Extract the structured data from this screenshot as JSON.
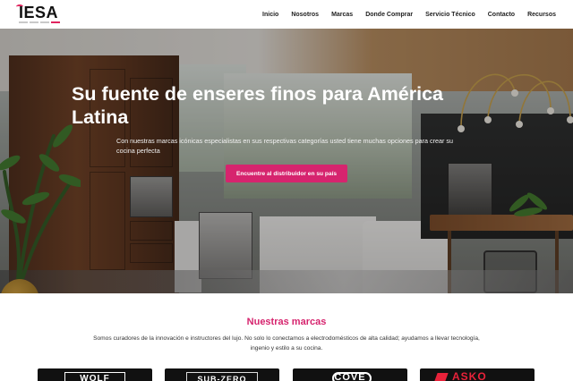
{
  "brand": {
    "logo_text": "IESA",
    "accent": "#d6246e"
  },
  "nav": {
    "items": [
      "Inicio",
      "Nosotros",
      "Marcas",
      "Donde Comprar",
      "Servicio Técnico",
      "Contacto",
      "Recursos"
    ]
  },
  "hero": {
    "title": "Su fuente de enseres finos para América Latina",
    "subtitle": "Con nuestras marcas icónicas especialistas en sus respectivas categorías usted tiene muchas opciones para crear su cocina perfecta",
    "cta_label": "Encuentre al distribuidor en su país"
  },
  "marcas": {
    "title": "Nuestras marcas",
    "description": "Somos curadores de la innovación e instructores del lujo. No solo lo conectamos a electrodomésticos de alta calidad; ayudamos a llevar tecnología, ingenio y estilo a su cocina.",
    "brands": [
      "WOLF",
      "SUB-ZERO",
      "COVE",
      "ASKO"
    ]
  }
}
